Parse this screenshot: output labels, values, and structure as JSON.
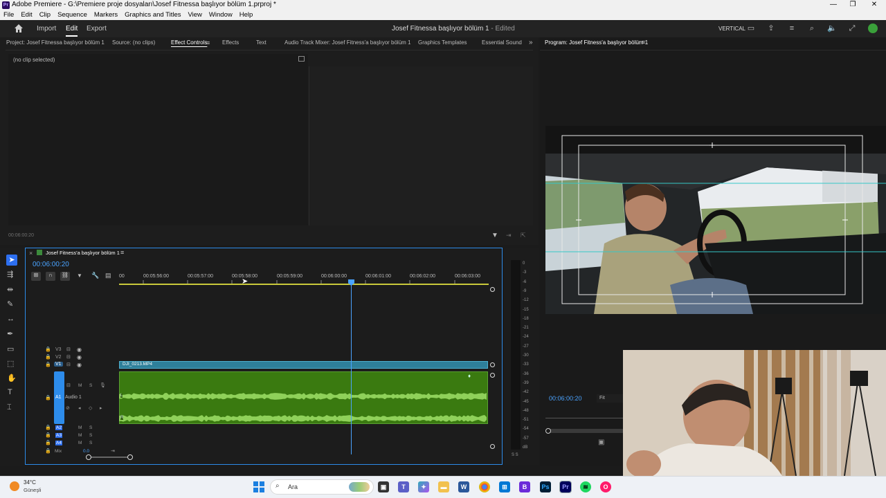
{
  "window": {
    "title": "Adobe Premiere - G:\\Premiere proje dosyaları\\Josef Fitnessa başlıyor bölüm 1.prproj *",
    "app_badge": "Pr"
  },
  "menu": [
    "File",
    "Edit",
    "Clip",
    "Sequence",
    "Markers",
    "Graphics and Titles",
    "View",
    "Window",
    "Help"
  ],
  "header": {
    "import": "Import",
    "edit": "Edit",
    "export": "Export",
    "project_title": "Josef Fitnessa başlıyor bölüm 1",
    "edited": "- Edited",
    "workspace": "VERTICAL"
  },
  "source_panel": {
    "tabs": [
      "Project: Josef Fitnessa başlıyor bölüm 1",
      "Source: (no clips)",
      "Effect Controls",
      "Effects",
      "Text",
      "Audio Track Mixer: Josef Fitness'a başlıyor bölüm 1",
      "Graphics Templates",
      "Essential Sound"
    ],
    "no_clip": "(no clip selected)",
    "timecode": "00:06:00:20"
  },
  "program_panel": {
    "title": "Program: Josef Fitness'a başlıyor bölüm 1",
    "timecode": "00:06:00:20",
    "fit": "Fit"
  },
  "timeline": {
    "sequence_name": "Josef Fitness'a başlıyor bölüm 1",
    "timecode": "00:06:00:20",
    "ruler": [
      "00",
      "00:05:56:00",
      "00:05:57:00",
      "00:05:58:00",
      "00:05:59:00",
      "00:06:00:00",
      "00:06:01:00",
      "00:06:02:00",
      "00:06:03:00"
    ],
    "video_tracks": [
      "V3",
      "V2",
      "V1"
    ],
    "audio_tracks": [
      "A1",
      "A2",
      "A3",
      "A4"
    ],
    "audio1_label": "Audio 1",
    "mix_label": "Mix",
    "mix_value": "0.0",
    "clip_name": "DJI_0213.MP4",
    "track_buttons": {
      "m": "M",
      "s": "S"
    },
    "channel_l": "L",
    "channel_r": "R"
  },
  "meter": {
    "labels": [
      "0",
      "-3",
      "-6",
      "-9",
      "-12",
      "-15",
      "-18",
      "-21",
      "-24",
      "-27",
      "-30",
      "-33",
      "-36",
      "-39",
      "-42",
      "-45",
      "-48",
      "-51",
      "-54",
      "-57",
      "dB"
    ],
    "solo": "S S"
  },
  "taskbar": {
    "weather_temp": "34°C",
    "weather_desc": "Güneşli",
    "search": "Ara"
  },
  "colors": {
    "accent_blue": "#2d8ceb",
    "clip_audio": "#3a7a10",
    "waveform": "#8fd15a",
    "clip_video": "#2e7f9a"
  }
}
